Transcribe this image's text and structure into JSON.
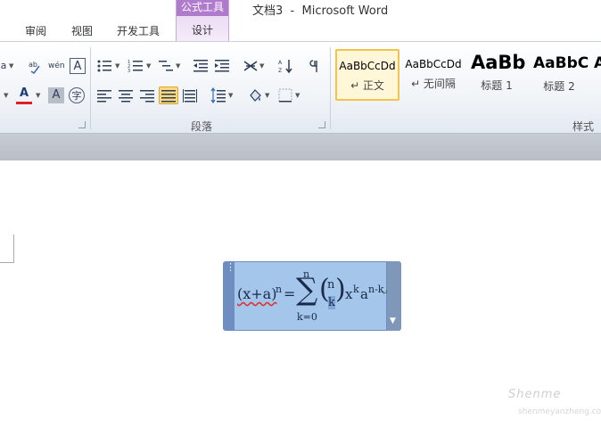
{
  "window": {
    "title": "文档3  -  Microsoft Word"
  },
  "tabs": {
    "review": "审阅",
    "view": "视图",
    "developer": "开发工具",
    "context_group": "公式工具",
    "design": "设计"
  },
  "ribbon": {
    "font_fragment": "a",
    "paragraph_group": "段落",
    "styles_group": "样式",
    "styles": [
      {
        "sample": "AaBbCcDd",
        "name": "↵ 正文",
        "selected": true
      },
      {
        "sample": "AaBbCcDd",
        "name": "↵ 无间隔",
        "selected": false
      },
      {
        "sample": "AaBb",
        "name": "标题 1",
        "selected": false
      },
      {
        "sample": "AaBbC",
        "name": "标题 2",
        "selected": false
      },
      {
        "sample": "A",
        "name": "",
        "selected": false
      }
    ],
    "icons": {
      "phonetic": "wén",
      "char_border": "A",
      "font_color": "A",
      "char_shading": "A",
      "enclose_char": "字",
      "sort": "↓"
    }
  },
  "equation": {
    "lhs": "(x+a)",
    "lhs_exp": "n",
    "equals": "=",
    "sum_upper": "n",
    "sum_lower": "k=0",
    "binom_top": "n",
    "binom_bottom": "k",
    "term_x": "x",
    "term_x_exp": "k",
    "term_a": "a",
    "term_a_exp": "n-k",
    "handle_dots": "⋮",
    "menu_arrow": "▼",
    "end_mark": "↵"
  },
  "watermark": {
    "text": "Shenme",
    "sub": "shenmeyanzheng.com"
  },
  "colors": {
    "context_tab": "#b07bcc",
    "equation_bg": "#a3c6ea",
    "equation_handle": "#6d8ebf",
    "style_selected_border": "#f4c34c",
    "font_color_bar": "#e02020"
  }
}
